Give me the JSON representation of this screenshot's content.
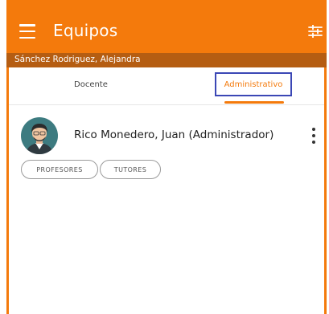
{
  "header": {
    "title": "Equipos",
    "menu_icon": "hamburger-menu-icon",
    "filter_icon": "sliders-icon"
  },
  "subheader": {
    "user_name": "Sánchez Rodriguez, Alejandra"
  },
  "tabs": [
    {
      "label": "Docente",
      "selected": false
    },
    {
      "label": "Administrativo",
      "selected": true
    }
  ],
  "members": [
    {
      "name": "Rico Monedero, Juan (Administrador)",
      "avatar_icon": "avatar-icon",
      "chips": [
        "PROFESORES",
        "TUTORES"
      ]
    }
  ],
  "colors": {
    "accent": "#f47a0c",
    "subheader_bg": "#b55d12",
    "highlight_border": "#3b47b5"
  }
}
